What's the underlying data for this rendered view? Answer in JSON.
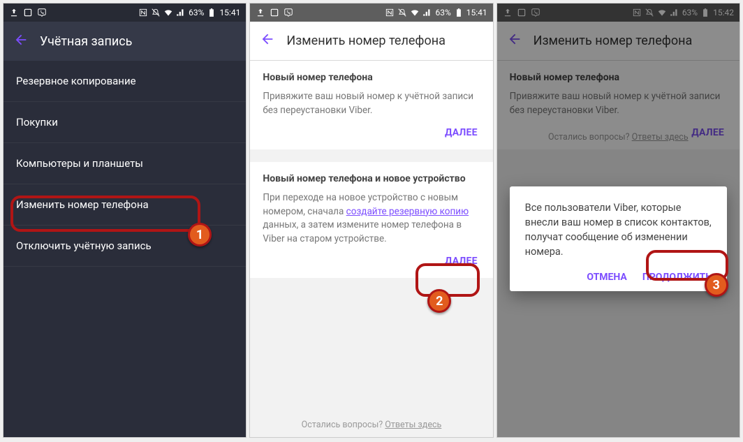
{
  "status": {
    "time1": "15:41",
    "time2": "15:41",
    "time3": "15:42",
    "battery": "63%",
    "signal_icon": "signal-icon",
    "wifi_icon": "wifi-icon",
    "battery_icon": "battery-icon",
    "upload_icon": "upload-icon",
    "screenshot_icon": "screenshot-icon",
    "viber_icon": "viber-icon",
    "nfc_icon": "nfc-icon",
    "mute_icon": "mute-icon"
  },
  "screen1": {
    "title": "Учётная запись",
    "items": [
      {
        "label": "Резервное копирование"
      },
      {
        "label": "Покупки"
      },
      {
        "label": "Компьютеры и планшеты"
      },
      {
        "label": "Изменить номер телефона"
      },
      {
        "label": "Отключить учётную запись"
      }
    ],
    "badge": "1"
  },
  "screen2": {
    "title": "Изменить номер телефона",
    "card1": {
      "title": "Новый номер телефона",
      "body": "Привяжите ваш новый номер к учётной записи без переустановки Viber.",
      "action": "ДАЛЕЕ"
    },
    "card2": {
      "title": "Новый номер телефона и новое устройство",
      "body_pre": "При переходе на новое устройство с новым номером, сначала ",
      "body_link": "создайте резервную копию",
      "body_post": " данных, а затем измените номер телефона в Viber на старом устройстве.",
      "action": "ДАЛЕЕ"
    },
    "footer_q": "Остались вопросы? ",
    "footer_a": "Ответы здесь",
    "badge": "2"
  },
  "screen3": {
    "title": "Изменить номер телефона",
    "card1": {
      "title": "Новый номер телефона",
      "body": "Привяжите ваш новый номер к учётной записи без переустановки Viber.",
      "action": "ДАЛЕЕ"
    },
    "dialog": {
      "text": "Все пользователи Viber, которые внесли ваш номер в список контактов, получат сообщение об изменении номера.",
      "cancel": "ОТМЕНА",
      "ok": "ПРОДОЛЖИТЬ"
    },
    "footer_q": "Остались вопросы? ",
    "footer_a": "Ответы здесь",
    "badge": "3"
  }
}
